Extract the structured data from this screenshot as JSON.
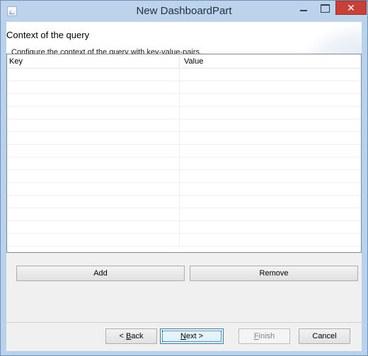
{
  "window": {
    "title": "New DashboardPart",
    "close_glyph": "✕",
    "icons": [
      "app-icon",
      "minimize-icon",
      "maximize-icon",
      "close-icon"
    ]
  },
  "header": {
    "title": "Context of the query",
    "description": "Configure the context of the query with key-value-pairs."
  },
  "table": {
    "columns": [
      "Key",
      "Value"
    ],
    "rows": []
  },
  "buttons": {
    "add": "Add",
    "remove": "Remove",
    "back_prefix": "< ",
    "back_mnemonic": "B",
    "back_rest": "ack",
    "next_mnemonic": "N",
    "next_rest": "ext >",
    "finish_mnemonic": "F",
    "finish_rest": "inish",
    "cancel": "Cancel"
  },
  "colors": {
    "title_bar": "#bcd3eb",
    "close_button": "#c7413a",
    "dialog_background": "#f0f0f0",
    "disabled_text": "#838383"
  }
}
